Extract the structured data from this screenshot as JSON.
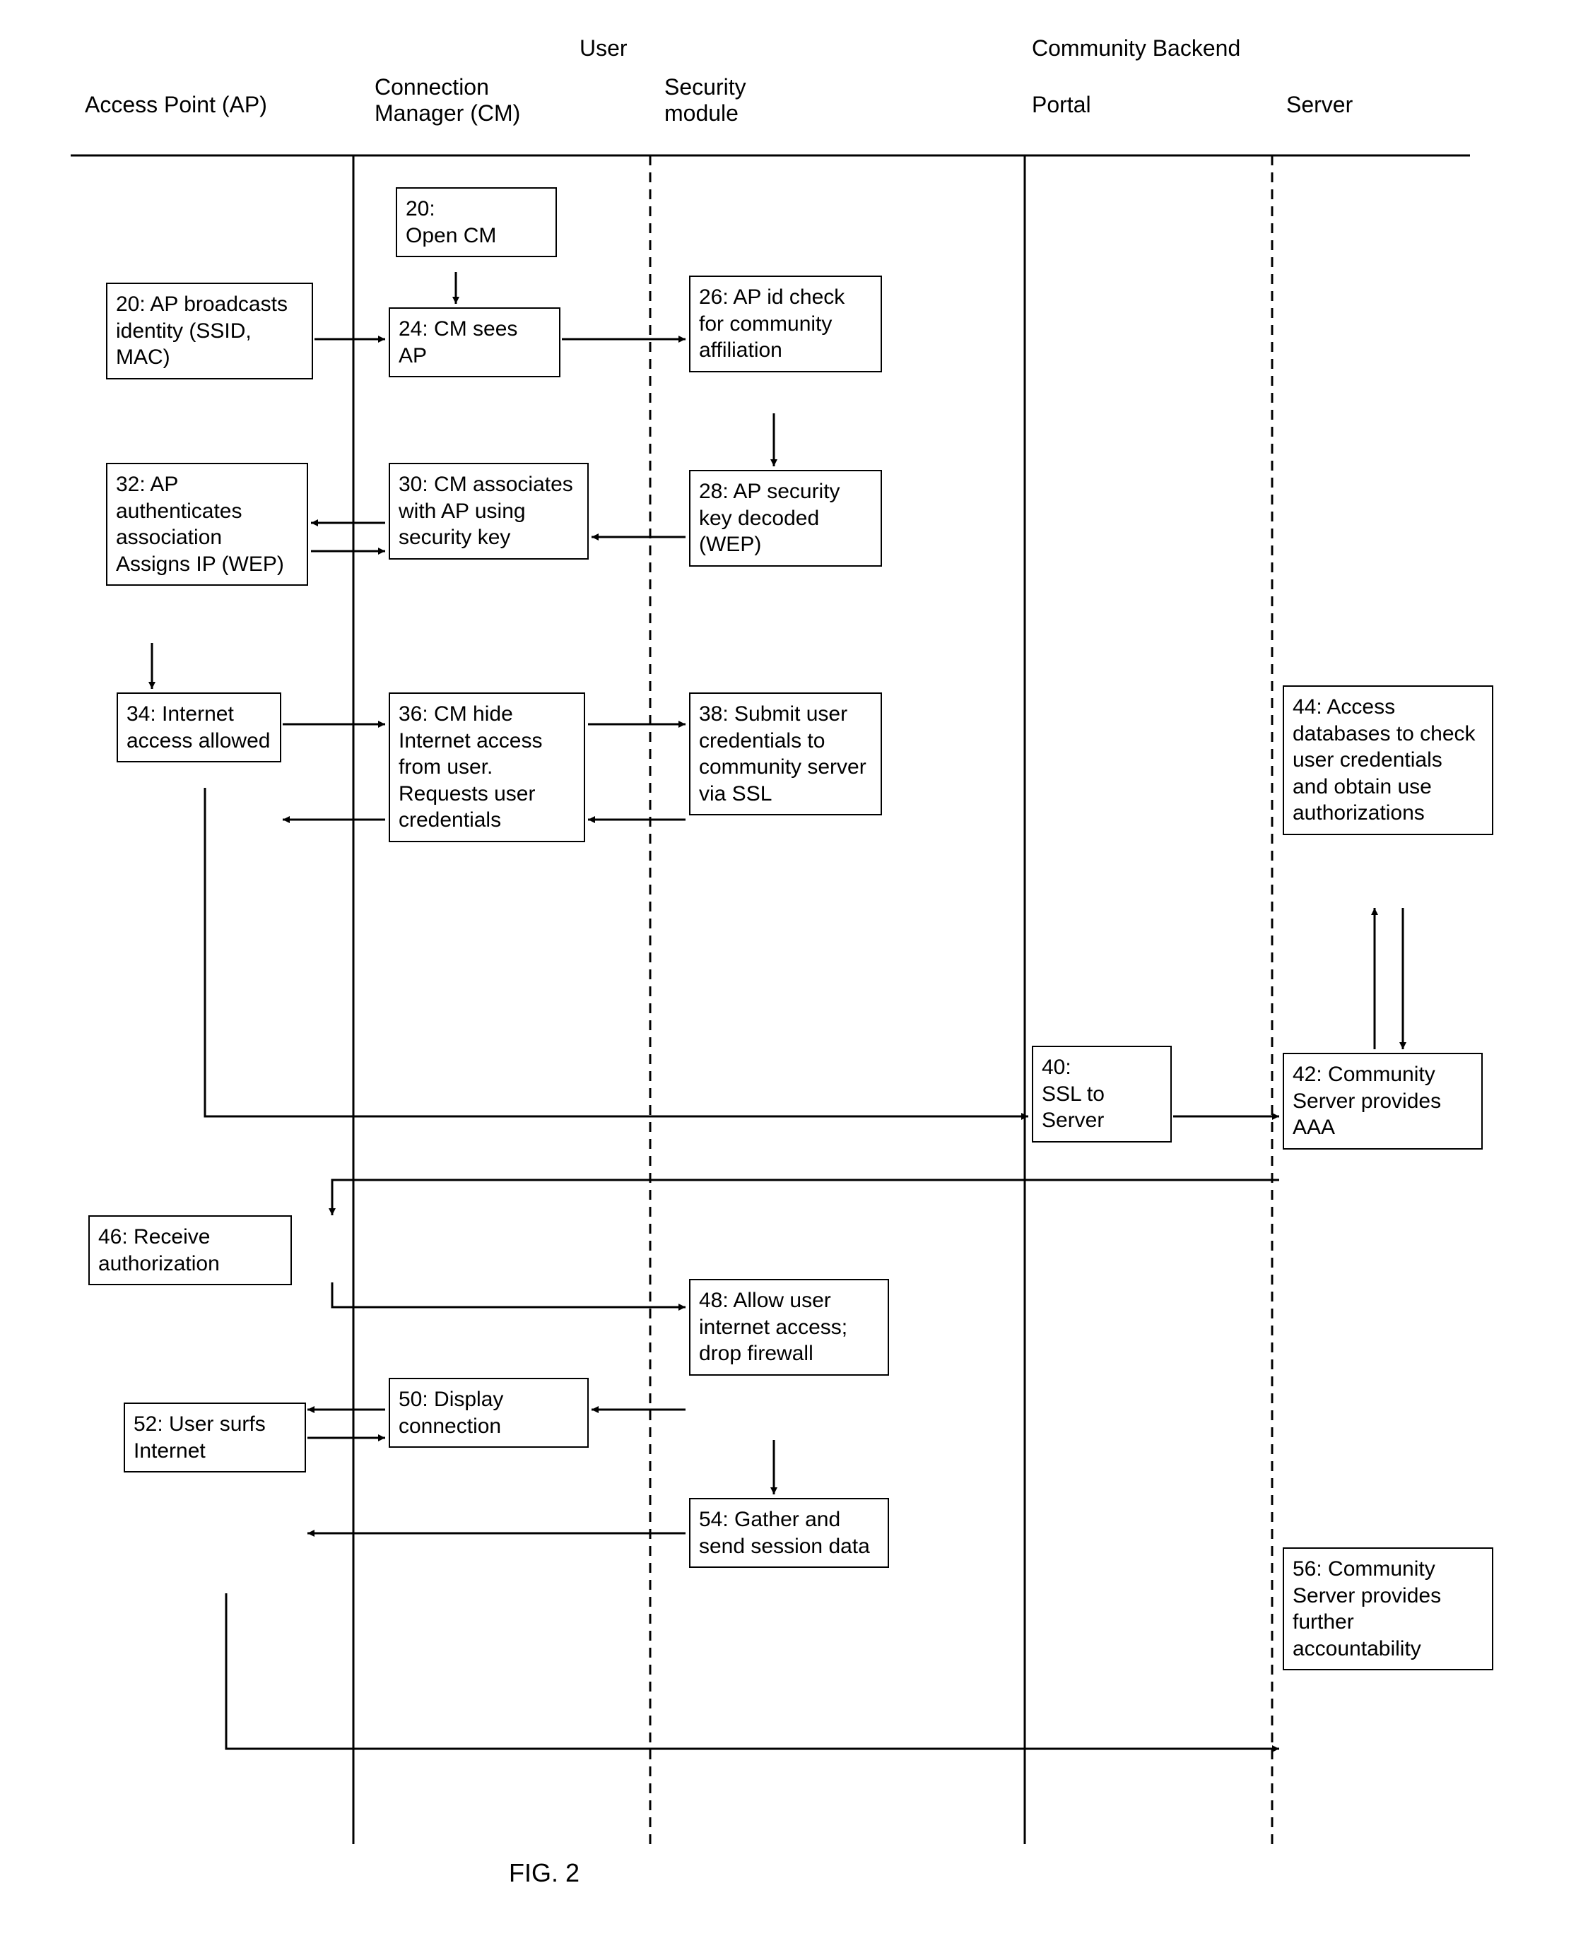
{
  "headers": {
    "user": "User",
    "backend": "Community Backend",
    "ap": "Access Point (AP)",
    "cm": "Connection Manager (CM)",
    "sec": "Security module",
    "portal": "Portal",
    "server": "Server"
  },
  "boxes": {
    "b20a": "20:\nOpen CM",
    "b20b": "20:  AP broadcasts identity (SSID, MAC)",
    "b24": "24:  CM sees AP",
    "b26": "26:  AP id check for community affiliation",
    "b28": "28:  AP security key decoded (WEP)",
    "b30": "30:  CM associates with AP using security key",
    "b32": "32:  AP authenticates association Assigns IP (WEP)",
    "b34": "34:  Internet access allowed",
    "b36": "36:  CM hide Internet access from user. Requests user credentials",
    "b38": "38:  Submit user credentials to community server via SSL",
    "b40": "40:\nSSL to Server",
    "b42": "42: Community Server provides AAA",
    "b44": "44:  Access databases to check user credentials and obtain use authorizations",
    "b46": "46:  Receive authorization",
    "b48": "48:  Allow user internet access; drop firewall",
    "b50": "50:  Display connection",
    "b52": "52:  User surfs Internet",
    "b54": "54:  Gather and send session data",
    "b56": "56: Community Server provides further accountability"
  },
  "caption": "FIG. 2"
}
